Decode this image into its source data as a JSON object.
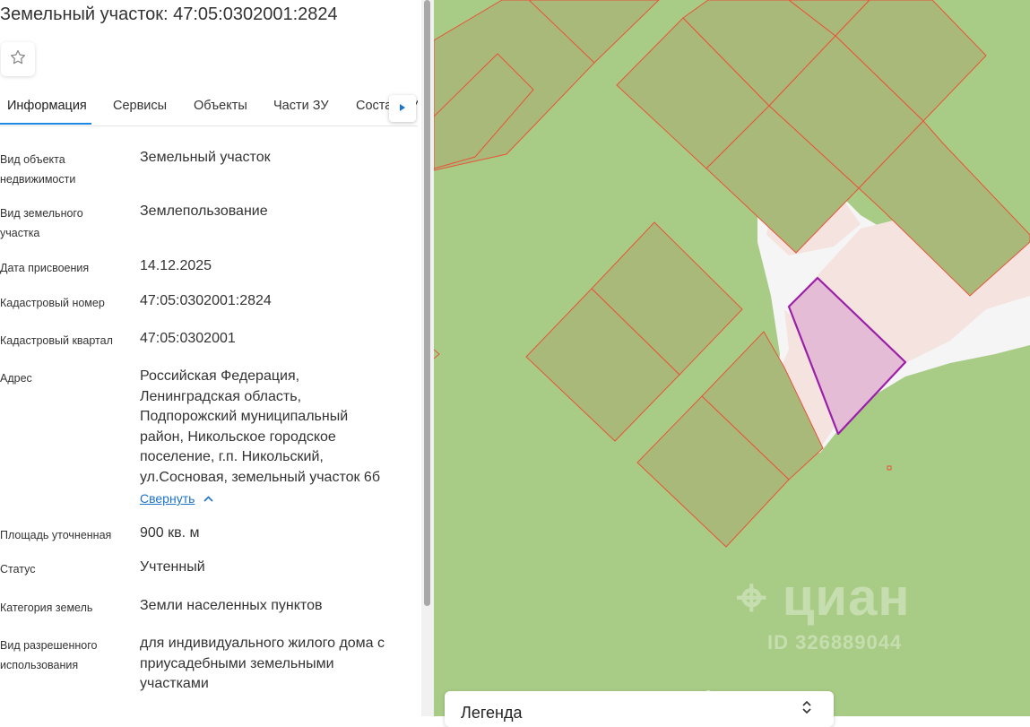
{
  "header": {
    "title": "Земельный участок: 47:05:0302001:2824"
  },
  "tabs": [
    {
      "label": "Информация"
    },
    {
      "label": "Сервисы"
    },
    {
      "label": "Объекты"
    },
    {
      "label": "Части ЗУ"
    },
    {
      "label": "Состав ЗУ"
    }
  ],
  "info": [
    {
      "label_lines": [
        "Вид объекта",
        "недвижимости"
      ],
      "value": "Земельный участок"
    },
    {
      "label_lines": [
        "Вид земельного",
        "участка"
      ],
      "value": "Землепользование"
    },
    {
      "label_lines": [
        "Дата присвоения"
      ],
      "value": "14.12.2025"
    },
    {
      "label_lines": [
        "Кадастровый номер"
      ],
      "value": "47:05:0302001:2824"
    },
    {
      "label_lines": [
        "Кадастровый квартал"
      ],
      "value": "47:05:0302001"
    },
    {
      "label_lines": [
        "Адрес"
      ],
      "value_lines": [
        "Российская Федерация,",
        "Ленинградская область,",
        "Подпорожский муниципальный",
        "район, Никольское городское",
        "поселение, г.п. Никольский,",
        "ул.Сосновая, земельный участок 6б"
      ]
    },
    {
      "label_lines": [
        "Площадь уточненная"
      ],
      "value": "900 кв. м"
    },
    {
      "label_lines": [
        "Статус"
      ],
      "value": "Учтенный"
    },
    {
      "label_lines": [
        "Категория земель"
      ],
      "value": "Земли населенных пунктов"
    },
    {
      "label_lines": [
        "Вид разрешенного",
        "использования"
      ],
      "value_lines": [
        "для индивидуального жилого дома с",
        "приусадебными земельными",
        "участками"
      ]
    }
  ],
  "address_toggle": "Свернуть",
  "legend": {
    "title": "Легенда"
  },
  "watermark": {
    "brand": "циан",
    "id": "ID 326889044"
  },
  "colors": {
    "accent": "#1e88e5",
    "map_green": "#a8cc85",
    "parcel_fill": "#a9b97a",
    "parcel_border": "#e8543a",
    "selected_border": "#9b1fa8",
    "selected_fill": "#e4bcd6"
  },
  "icons": {
    "favorite": "star-icon",
    "tabs_next": "triangle-right-icon",
    "collapse": "chevron-up-icon",
    "legend_toggle": "chevron-up-down-icon"
  }
}
